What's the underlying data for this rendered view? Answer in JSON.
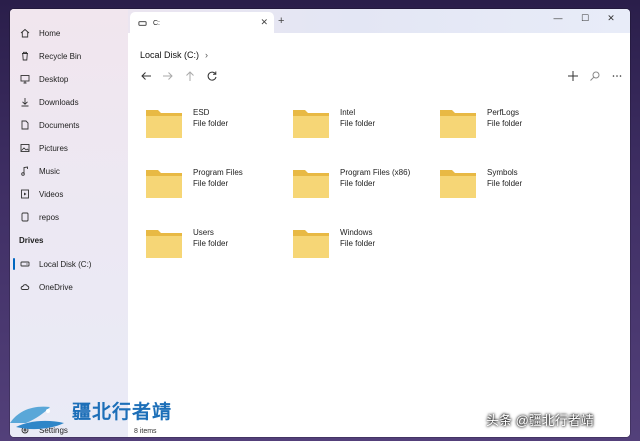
{
  "tab": {
    "title": "C:",
    "close": "✕",
    "new": "+"
  },
  "window_controls": {
    "minimize": "—",
    "maximize": "☐",
    "close": "✕"
  },
  "sidebar": {
    "items": [
      {
        "label": "Home",
        "icon": "home-icon"
      },
      {
        "label": "Recycle Bin",
        "icon": "recycle-bin-icon"
      },
      {
        "label": "Desktop",
        "icon": "desktop-icon"
      },
      {
        "label": "Downloads",
        "icon": "downloads-icon"
      },
      {
        "label": "Documents",
        "icon": "documents-icon"
      },
      {
        "label": "Pictures",
        "icon": "pictures-icon"
      },
      {
        "label": "Music",
        "icon": "music-icon"
      },
      {
        "label": "Videos",
        "icon": "videos-icon"
      },
      {
        "label": "repos",
        "icon": "folder-icon"
      }
    ],
    "drives_heading": "Drives",
    "drives": [
      {
        "label": "Local Disk (C:)",
        "icon": "drive-icon",
        "active": true
      },
      {
        "label": "OneDrive",
        "icon": "cloud-icon"
      }
    ],
    "settings": "Settings"
  },
  "breadcrumb": {
    "location": "Local Disk (C:)",
    "chevron": "›"
  },
  "toolbar": {
    "back": "back-arrow-icon",
    "forward": "forward-arrow-icon",
    "up": "up-arrow-icon",
    "refresh": "refresh-icon",
    "new": "plus-icon",
    "search": "search-icon",
    "more": "more-icon"
  },
  "folders": [
    {
      "name": "ESD",
      "type": "File folder"
    },
    {
      "name": "Intel",
      "type": "File folder"
    },
    {
      "name": "PerfLogs",
      "type": "File folder"
    },
    {
      "name": "Program Files",
      "type": "File folder"
    },
    {
      "name": "Program Files (x86)",
      "type": "File folder"
    },
    {
      "name": "Symbols",
      "type": "File folder"
    },
    {
      "name": "Users",
      "type": "File folder"
    },
    {
      "name": "Windows",
      "type": "File folder"
    }
  ],
  "status": {
    "count": "8 items"
  },
  "watermark": {
    "brand": "疆北行者靖",
    "source": "头条 @疆北行者靖"
  },
  "colors": {
    "accent": "#0067c0",
    "folder": "#f6d676",
    "folder_tab": "#e8b944"
  }
}
